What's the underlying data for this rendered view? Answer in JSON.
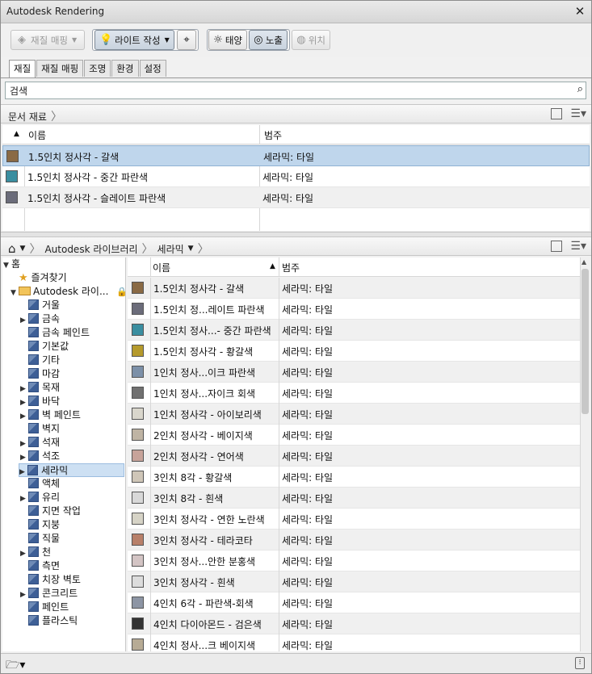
{
  "window": {
    "title": "Autodesk Rendering"
  },
  "toolbar": {
    "material_mapping": "재질 매핑",
    "create_light": "라이트 작성",
    "sun": "태양",
    "exposure": "노출",
    "location": "위치"
  },
  "tabs": [
    "재질",
    "재질 매핑",
    "조명",
    "환경",
    "설정"
  ],
  "search": {
    "value": "검색"
  },
  "document": {
    "breadcrumb": "문서 재료",
    "headers": {
      "name": "이름",
      "category": "범주"
    },
    "rows": [
      {
        "name": "1.5인치 정사각 - 갈색",
        "category": "세라믹: 타일",
        "color": "#8a6a45"
      },
      {
        "name": "1.5인치 정사각 - 중간 파란색",
        "category": "세라믹: 타일",
        "color": "#3a8ea0"
      },
      {
        "name": "1.5인치 정사각 - 슬레이트 파란색",
        "category": "세라믹: 타일",
        "color": "#6b6c7a"
      }
    ]
  },
  "library": {
    "breadcrumb": [
      "Autodesk 라이브러리",
      "세라믹"
    ],
    "headers": {
      "name": "이름",
      "category": "범주"
    },
    "tree": {
      "home": "홈",
      "favorites": "즐겨찾기",
      "root": "Autodesk 라이...",
      "items": [
        {
          "label": "거울",
          "expandable": false
        },
        {
          "label": "금속",
          "expandable": true
        },
        {
          "label": "금속 페인트",
          "expandable": false
        },
        {
          "label": "기본값",
          "expandable": false
        },
        {
          "label": "기타",
          "expandable": false
        },
        {
          "label": "마감",
          "expandable": false
        },
        {
          "label": "목재",
          "expandable": true
        },
        {
          "label": "바닥",
          "expandable": true
        },
        {
          "label": "벽 페인트",
          "expandable": true
        },
        {
          "label": "벽지",
          "expandable": false
        },
        {
          "label": "석재",
          "expandable": true
        },
        {
          "label": "석조",
          "expandable": true
        },
        {
          "label": "세라믹",
          "expandable": true,
          "selected": true
        },
        {
          "label": "액체",
          "expandable": false
        },
        {
          "label": "유리",
          "expandable": true
        },
        {
          "label": "지면 작업",
          "expandable": false
        },
        {
          "label": "지붕",
          "expandable": false
        },
        {
          "label": "직물",
          "expandable": false
        },
        {
          "label": "천",
          "expandable": true
        },
        {
          "label": "측면",
          "expandable": false
        },
        {
          "label": "치장 벽토",
          "expandable": false
        },
        {
          "label": "콘크리트",
          "expandable": true
        },
        {
          "label": "페인트",
          "expandable": false
        },
        {
          "label": "플라스틱",
          "expandable": false
        }
      ]
    },
    "rows": [
      {
        "name": "1.5인치 정사각 - 갈색",
        "category": "세라믹: 타일",
        "color": "#8a6a45"
      },
      {
        "name": "1.5인치 정...레이트 파란색",
        "category": "세라믹: 타일",
        "color": "#6b6c7a"
      },
      {
        "name": "1.5인치 정사...- 중간 파란색",
        "category": "세라믹: 타일",
        "color": "#3a8ea0"
      },
      {
        "name": "1.5인치 정사각 - 황갈색",
        "category": "세라믹: 타일",
        "color": "#b59a2c"
      },
      {
        "name": "1인치 정사...이크 파란색",
        "category": "세라믹: 타일",
        "color": "#7c90a8"
      },
      {
        "name": "1인치 정사...자이크 회색",
        "category": "세라믹: 타일",
        "color": "#707070"
      },
      {
        "name": "1인치 정사각 - 아이보리색",
        "category": "세라믹: 타일",
        "color": "#d9d6cc"
      },
      {
        "name": "2인치 정사각 - 베이지색",
        "category": "세라믹: 타일",
        "color": "#bfb4a4"
      },
      {
        "name": "2인치 정사각 - 연어색",
        "category": "세라믹: 타일",
        "color": "#c7a39a"
      },
      {
        "name": "3인치 8각 - 황갈색",
        "category": "세라믹: 타일",
        "color": "#cfc6b8"
      },
      {
        "name": "3인치 8각 - 흰색",
        "category": "세라믹: 타일",
        "color": "#d8d8d8"
      },
      {
        "name": "3인치 정사각 - 연한 노란색",
        "category": "세라믹: 타일",
        "color": "#d6d3c6"
      },
      {
        "name": "3인치 정사각 - 테라코타",
        "category": "세라믹: 타일",
        "color": "#b8806a"
      },
      {
        "name": "3인치 정사...안한 분홍색",
        "category": "세라믹: 타일",
        "color": "#d3c4c4"
      },
      {
        "name": "3인치 정사각 - 흰색",
        "category": "세라믹: 타일",
        "color": "#dcdcdc"
      },
      {
        "name": "4인치 6각 - 파란색-회색",
        "category": "세라믹: 타일",
        "color": "#8d95a4"
      },
      {
        "name": "4인치 다이아몬드 - 검은색",
        "category": "세라믹: 타일",
        "color": "#333333"
      },
      {
        "name": "4인치 정사...크 베이지색",
        "category": "세라믹: 타일",
        "color": "#b7ab95"
      }
    ]
  }
}
